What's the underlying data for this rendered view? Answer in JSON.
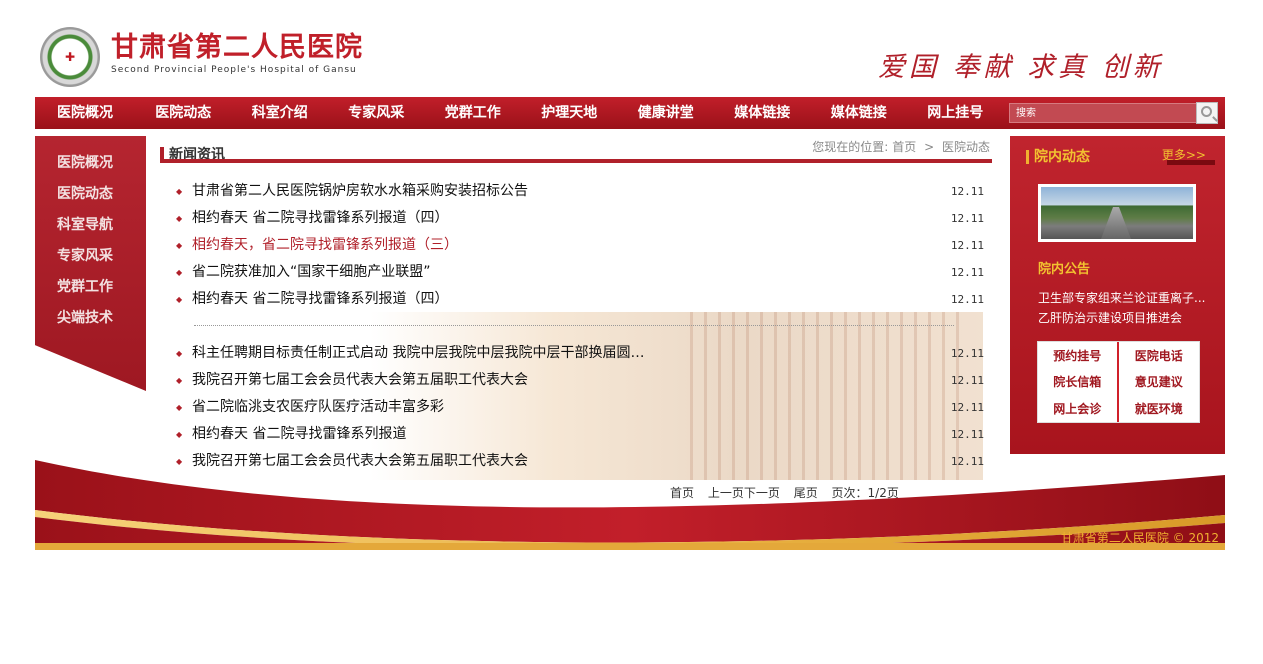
{
  "header": {
    "site_title": "甘肃省第二人民医院",
    "site_subtitle": "Second Provincial People's Hospital of Gansu",
    "slogan": "爱国 奉献 求真 创新"
  },
  "nav": {
    "items": [
      {
        "label": "医院概况"
      },
      {
        "label": "医院动态"
      },
      {
        "label": "科室介绍"
      },
      {
        "label": "专家风采"
      },
      {
        "label": "党群工作"
      },
      {
        "label": "护理天地"
      },
      {
        "label": "健康讲堂"
      },
      {
        "label": "媒体链接"
      },
      {
        "label": "媒体链接"
      },
      {
        "label": "网上挂号"
      }
    ],
    "search_placeholder": "搜索"
  },
  "left_menu": {
    "items": [
      {
        "label": "医院概况"
      },
      {
        "label": "医院动态"
      },
      {
        "label": "科室导航"
      },
      {
        "label": "专家风采"
      },
      {
        "label": "党群工作"
      },
      {
        "label": "尖端技术"
      }
    ]
  },
  "main": {
    "section_title": "新闻资讯",
    "breadcrumb": {
      "prefix": "您现在的位置:",
      "home": "首页",
      "separator": ">",
      "current": "医院动态"
    },
    "news_group1": [
      {
        "title": "甘肃省第二人民医院锅炉房软水水箱采购安装招标公告",
        "date": "12.11"
      },
      {
        "title": "相约春天 省二院寻找雷锋系列报道（四）",
        "date": "12.11"
      },
      {
        "title": "相约春天，省二院寻找雷锋系列报道（三）",
        "date": "12.11"
      },
      {
        "title": "省二院获准加入“国家干细胞产业联盟”",
        "date": "12.11"
      },
      {
        "title": "相约春天 省二院寻找雷锋系列报道（四）",
        "date": "12.11"
      }
    ],
    "news_group2": [
      {
        "title": "科主任聘期目标责任制正式启动 我院中层我院中层我院中层干部换届圆…",
        "date": "12.11"
      },
      {
        "title": "我院召开第七届工会会员代表大会第五届职工代表大会",
        "date": "12.11"
      },
      {
        "title": "省二院临洮支农医疗队医疗活动丰富多彩",
        "date": "12.11"
      },
      {
        "title": "相约春天 省二院寻找雷锋系列报道",
        "date": "12.11"
      },
      {
        "title": "我院召开第七届工会会员代表大会第五届职工代表大会",
        "date": "12.11"
      }
    ],
    "pager": {
      "first": "首页",
      "prev": "上一页",
      "next": "下一页",
      "last": "尾页",
      "page_info": "页次：1/2页"
    }
  },
  "right_panel": {
    "title": "院内动态",
    "more": "更多>>",
    "notice_title": "院内公告",
    "notices": [
      {
        "text": "卫生部专家组来兰论证重离子..."
      },
      {
        "text": "乙肝防治示建设项目推进会"
      }
    ],
    "quick_links": [
      {
        "label": "预约挂号"
      },
      {
        "label": "医院电话"
      },
      {
        "label": "院长信箱"
      },
      {
        "label": "意见建议"
      },
      {
        "label": "网上会诊"
      },
      {
        "label": "就医环境"
      }
    ]
  },
  "footer": {
    "copyright": "甘肃省第二人民医院 © 2012"
  },
  "colors": {
    "brand_red": "#b0202a",
    "accent_gold": "#f2c230"
  }
}
